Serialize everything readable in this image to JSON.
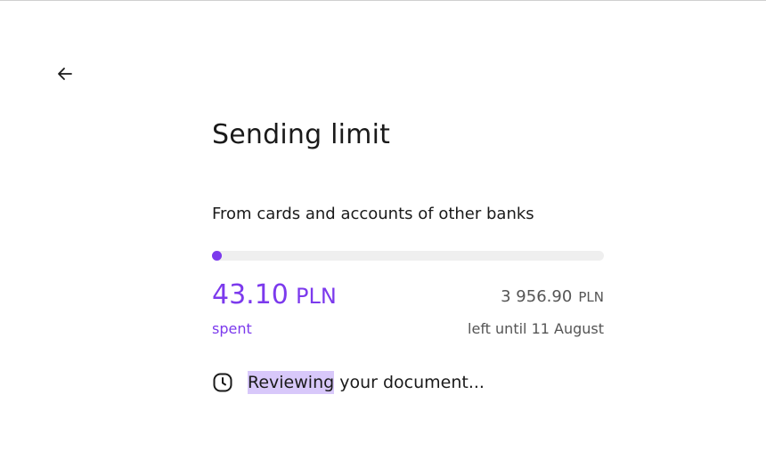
{
  "header": {
    "back_icon": "arrow-left-icon"
  },
  "limit": {
    "title": "Sending limit",
    "subtitle": "From cards and accounts of other banks",
    "progress_fraction": 0.0108,
    "spent_value": "43.10",
    "spent_currency": "PLN",
    "spent_label": "spent",
    "remaining_value": "3 956.90",
    "remaining_currency": "PLN",
    "remaining_label": "left until 11 August"
  },
  "status": {
    "icon": "clock-icon",
    "highlighted_text": "Reviewing",
    "rest_text": " your document..."
  },
  "colors": {
    "accent": "#7c3aed",
    "track": "#efefef",
    "highlight": "#d8c8fa",
    "muted_text": "#555555"
  }
}
